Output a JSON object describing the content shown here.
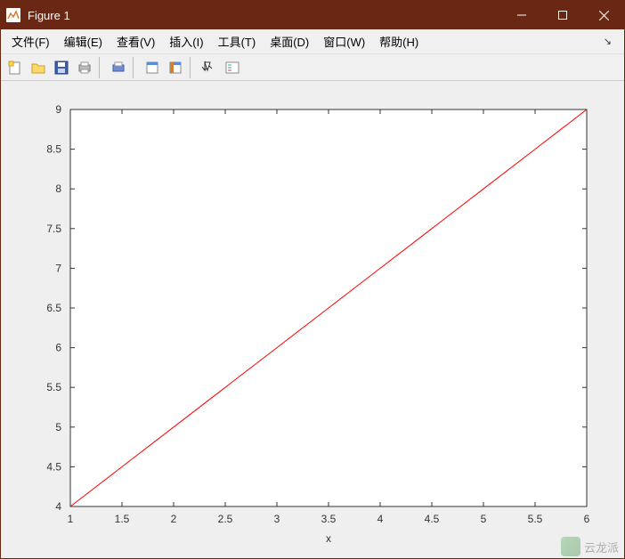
{
  "window": {
    "title": "Figure 1"
  },
  "menu": {
    "items": [
      "文件(F)",
      "编辑(E)",
      "查看(V)",
      "插入(I)",
      "工具(T)",
      "桌面(D)",
      "窗口(W)",
      "帮助(H)"
    ]
  },
  "chart_data": {
    "type": "line",
    "x": [
      1,
      1.5,
      2,
      2.5,
      3,
      3.5,
      4,
      4.5,
      5,
      5.5,
      6
    ],
    "y": [
      4,
      4.5,
      5,
      5.5,
      6,
      6.5,
      7,
      7.5,
      8,
      8.5,
      9
    ],
    "xlabel": "x",
    "ylabel": "",
    "xlim": [
      1,
      6
    ],
    "ylim": [
      4,
      9
    ],
    "xticks": [
      1,
      1.5,
      2,
      2.5,
      3,
      3.5,
      4,
      4.5,
      5,
      5.5,
      6
    ],
    "yticks": [
      4,
      4.5,
      5,
      5.5,
      6,
      6.5,
      7,
      7.5,
      8,
      8.5,
      9
    ],
    "line_color": "#ff0000"
  },
  "watermark": {
    "text": "云龙派"
  }
}
